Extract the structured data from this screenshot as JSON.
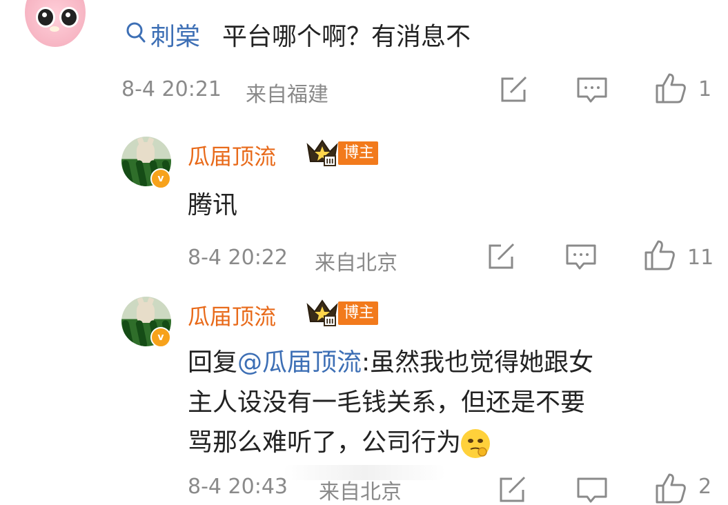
{
  "comment1": {
    "query_user": "刺棠",
    "text": "平台哪个啊？有消息不",
    "time": "8-4 20:21",
    "location": "来自福建",
    "likes": "1"
  },
  "reply1": {
    "username": "瓜届顶流",
    "tag": "博主",
    "verified_badge": "v",
    "crown_level": "III",
    "text": "腾讯",
    "time": "8-4 20:22",
    "location": "来自北京",
    "likes": "11"
  },
  "reply2": {
    "username": "瓜届顶流",
    "tag": "博主",
    "verified_badge": "v",
    "crown_level": "III",
    "reply_prefix": "回复",
    "mention": "@瓜届顶流",
    "line1": ":虽然我也觉得她跟女",
    "line2": "主人设没有一毛钱关系，但还是不要",
    "line3": "骂那么难听了，公司行为",
    "emoji_icon": "thinking-face-emoji",
    "time": "8-4 20:43",
    "location": "来自北京",
    "likes": "2"
  },
  "icons": {
    "repost": "repost-icon",
    "comment": "comment-icon",
    "like": "thumbs-up-icon",
    "search": "search-icon"
  },
  "colors": {
    "username": "#e86a1a",
    "link": "#3d6fb5",
    "meta": "#8a8a8a",
    "tag_bg": "#f27a1c"
  }
}
